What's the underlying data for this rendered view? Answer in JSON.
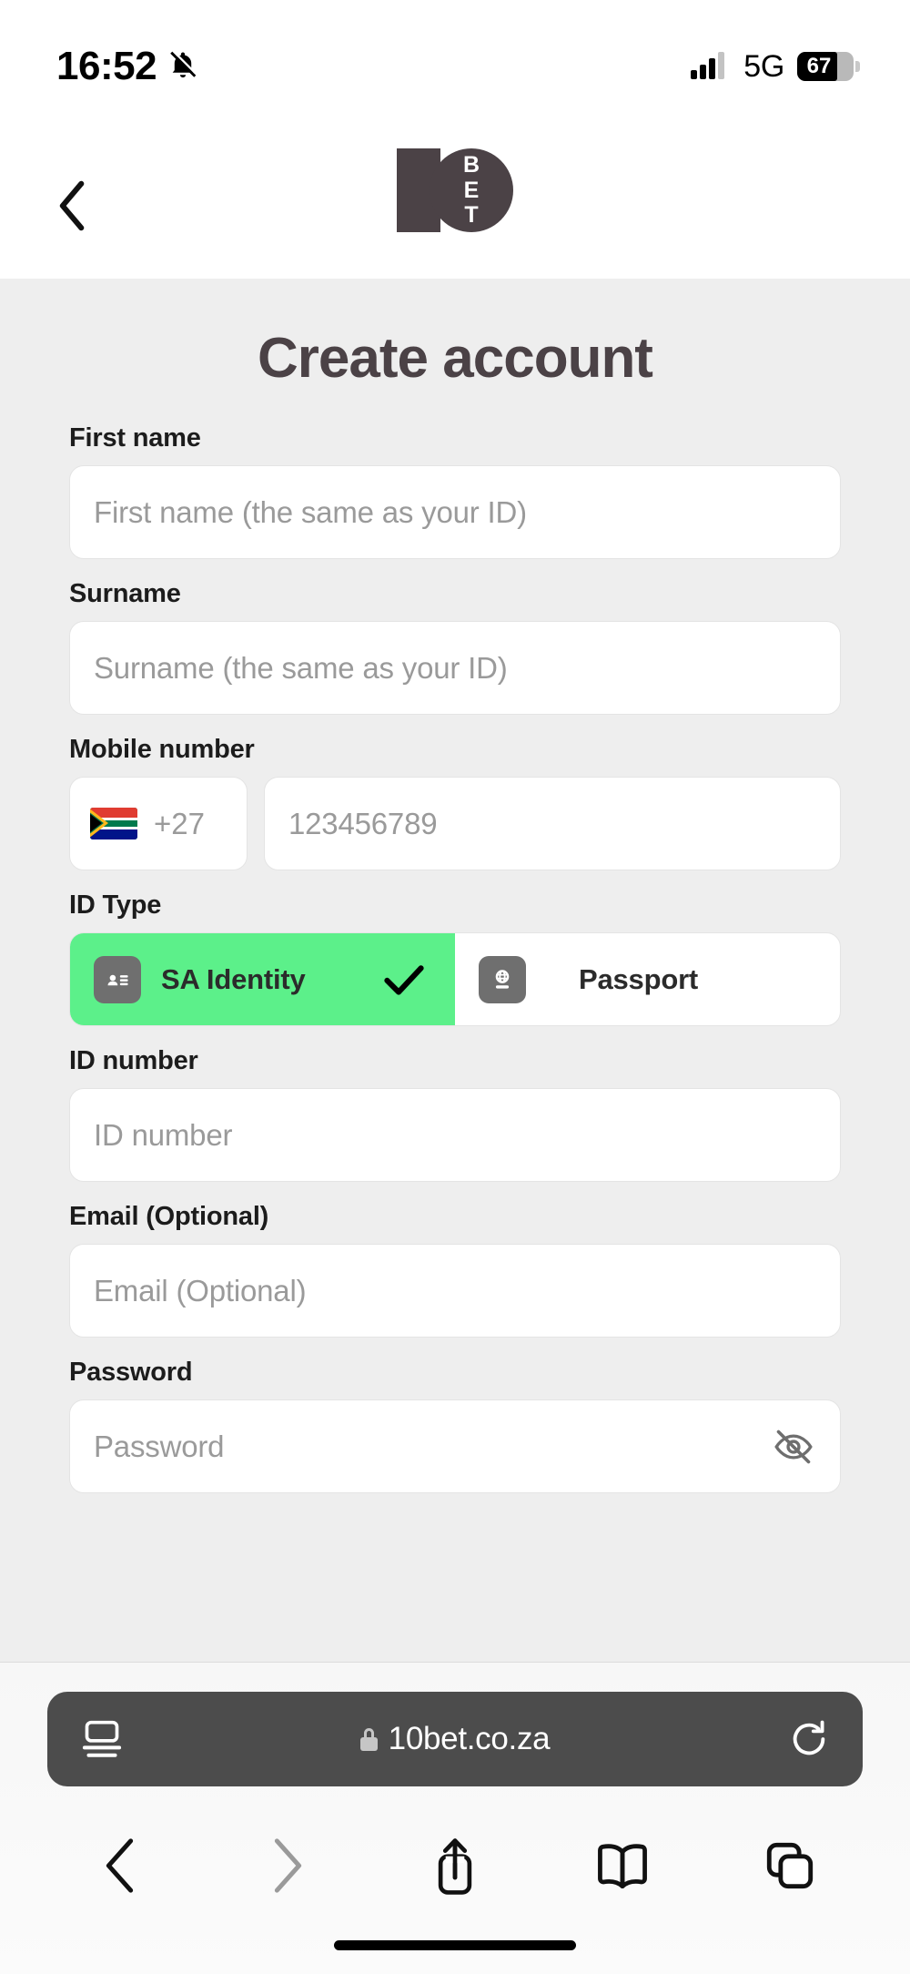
{
  "status_bar": {
    "time": "16:52",
    "silent_icon": "bell-slash-icon",
    "signal_icon": "cellular-bars-icon",
    "network": "5G",
    "battery_percent": "67"
  },
  "header": {
    "back_icon": "chevron-left-icon",
    "logo": {
      "name": "10bet-logo",
      "digit_one": "1",
      "digit_zero": "0",
      "letters": [
        "B",
        "E",
        "T"
      ]
    }
  },
  "page": {
    "title": "Create account",
    "fields": [
      {
        "label": "First name",
        "placeholder": "First name (the same as your ID)",
        "value": ""
      },
      {
        "label": "Surname",
        "placeholder": "Surname (the same as your ID)",
        "value": ""
      }
    ],
    "mobile": {
      "label": "Mobile number",
      "country_flag": "south-africa-flag-icon",
      "country_code": "+27",
      "placeholder": "123456789",
      "value": ""
    },
    "id_type": {
      "label": "ID Type",
      "options": [
        {
          "label": "SA Identity",
          "icon": "id-card-icon",
          "selected": true,
          "check_icon": "check-icon"
        },
        {
          "label": "Passport",
          "icon": "passport-icon",
          "selected": false
        }
      ]
    },
    "id_number": {
      "label": "ID number",
      "placeholder": "ID number",
      "value": ""
    },
    "email": {
      "label": "Email (Optional)",
      "placeholder": "Email (Optional)",
      "value": ""
    },
    "password": {
      "label": "Password",
      "placeholder": "Password",
      "value": "",
      "toggle_icon": "eye-slash-icon"
    }
  },
  "browser": {
    "page_settings_icon": "page-settings-aa-icon",
    "lock_icon": "lock-icon",
    "url": "10bet.co.za",
    "reload_icon": "reload-icon",
    "toolbar": [
      {
        "name": "back",
        "icon": "chevron-left-icon",
        "enabled": true
      },
      {
        "name": "forward",
        "icon": "chevron-right-icon",
        "enabled": false
      },
      {
        "name": "share",
        "icon": "share-icon",
        "enabled": true
      },
      {
        "name": "bookmarks",
        "icon": "book-icon",
        "enabled": true
      },
      {
        "name": "tabs",
        "icon": "tabs-icon",
        "enabled": true
      }
    ]
  },
  "colors": {
    "accent_green": "#5cf08a",
    "page_bg": "#eeeeee",
    "logo_dark": "#4b4246",
    "url_bar": "#4c4c4c"
  }
}
